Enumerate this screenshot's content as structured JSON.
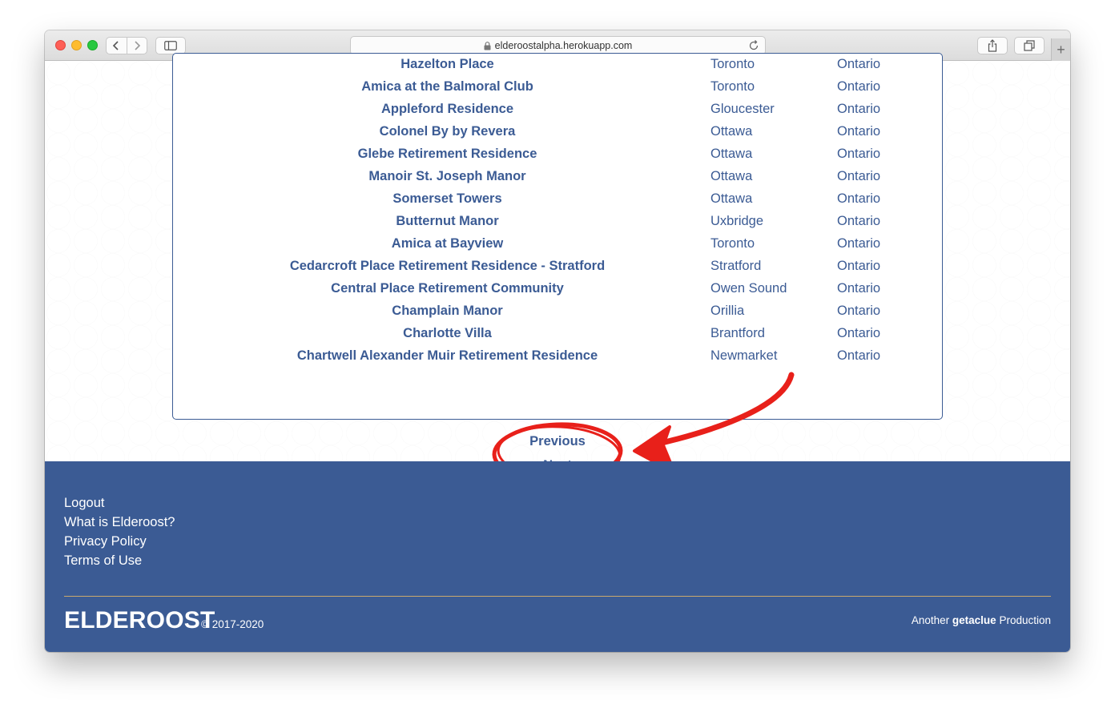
{
  "browser": {
    "url": "elderoostalpha.herokuapp.com",
    "icons": {
      "back": "chevron-left-icon",
      "forward": "chevron-right-icon",
      "sidebar": "sidebar-icon",
      "lock": "lock-icon",
      "reload": "reload-icon",
      "share": "share-icon",
      "tabs": "tabs-overview-icon",
      "new_tab": "plus-icon"
    }
  },
  "residences": [
    {
      "name": "Hazelton Place",
      "city": "Toronto",
      "province": "Ontario"
    },
    {
      "name": "Amica at the Balmoral Club",
      "city": "Toronto",
      "province": "Ontario"
    },
    {
      "name": "Appleford Residence",
      "city": "Gloucester",
      "province": "Ontario"
    },
    {
      "name": "Colonel By by Revera",
      "city": "Ottawa",
      "province": "Ontario"
    },
    {
      "name": "Glebe Retirement Residence",
      "city": "Ottawa",
      "province": "Ontario"
    },
    {
      "name": "Manoir St. Joseph Manor",
      "city": "Ottawa",
      "province": "Ontario"
    },
    {
      "name": "Somerset Towers",
      "city": "Ottawa",
      "province": "Ontario"
    },
    {
      "name": "Butternut Manor",
      "city": "Uxbridge",
      "province": "Ontario"
    },
    {
      "name": "Amica at Bayview",
      "city": "Toronto",
      "province": "Ontario"
    },
    {
      "name": "Cedarcroft Place Retirement Residence - Stratford",
      "city": "Stratford",
      "province": "Ontario"
    },
    {
      "name": "Central Place Retirement Community",
      "city": "Owen Sound",
      "province": "Ontario"
    },
    {
      "name": "Champlain Manor",
      "city": "Orillia",
      "province": "Ontario"
    },
    {
      "name": "Charlotte Villa",
      "city": "Brantford",
      "province": "Ontario"
    },
    {
      "name": "Chartwell Alexander Muir Retirement Residence",
      "city": "Newmarket",
      "province": "Ontario"
    }
  ],
  "pagination": {
    "previous": "Previous",
    "next": "Next"
  },
  "annotation": {
    "color": "#e8201a"
  },
  "footer": {
    "links": [
      "Logout",
      "What is Elderoost?",
      "Privacy Policy",
      "Terms of Use"
    ],
    "brand": "ELDEROOST",
    "copyright": "© 2017-2020",
    "credit_prefix": "Another",
    "credit_brand": "getaclue",
    "credit_suffix": "Production",
    "colors": {
      "background": "#3b5b94",
      "divider": "#c9a96e",
      "link": "#3b5b94"
    }
  }
}
